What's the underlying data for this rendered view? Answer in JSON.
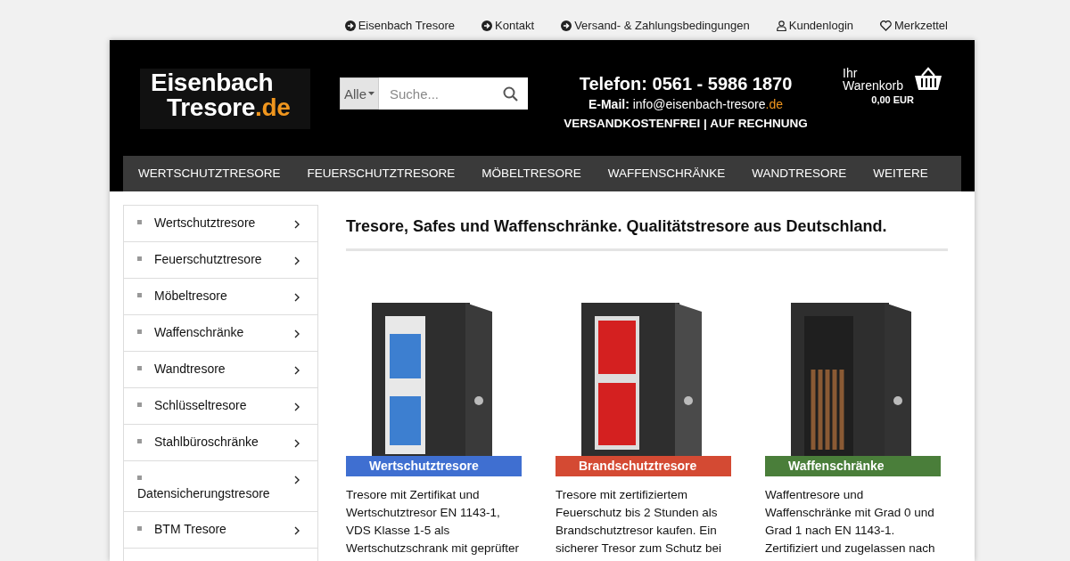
{
  "top_links": [
    {
      "kind": "arrow",
      "label": "Eisenbach Tresore"
    },
    {
      "kind": "arrow",
      "label": "Kontakt"
    },
    {
      "kind": "arrow",
      "label": "Versand- & Zahlungsbedingungen"
    },
    {
      "kind": "user",
      "label": "Kundenlogin"
    },
    {
      "kind": "heart",
      "label": "Merkzettel"
    }
  ],
  "logo": {
    "line1": "Eisenbach",
    "line2": "Tresore",
    "suffix": ".de"
  },
  "search": {
    "category": "Alle",
    "placeholder": "Suche..."
  },
  "contact": {
    "phone": "Telefon: 0561 - 5986 1870",
    "email_label": "E-Mail:",
    "email_name": "info@eisenbach-tresore",
    "email_tld": ".de",
    "tagline": "VERSANDKOSTENFREI | AUF RECHNUNG"
  },
  "cart": {
    "label": "Ihr Warenkorb",
    "total": "0,00 EUR"
  },
  "nav": [
    "WERTSCHUTZTRESORE",
    "FEUERSCHUTZTRESORE",
    "MÖBELTRESORE",
    "WAFFENSCHRÄNKE",
    "WANDTRESORE",
    "WEITERE"
  ],
  "sidebar": {
    "items": [
      "Wertschutztresore",
      "Feuerschutztresore",
      "Möbeltresore",
      "Waffenschränke",
      "Wandtresore",
      "Schlüsseltresore",
      "Stahlbüroschränke",
      "Datensicherungstresore",
      "BTM Tresore"
    ]
  },
  "heading": "Tresore, Safes und Waffenschränke. Qualitätstresore aus Deutschland.",
  "categories": [
    {
      "label": "Wertschutztresore",
      "color": "#3f6fd1",
      "lines": [
        "Tresore mit Zertifikat und",
        "Wertschutztresor EN 1143-1,",
        "VDS Klasse 1-5 als",
        "Wertschutzschrank mit geprüfter"
      ]
    },
    {
      "label": "Brandschutztresore",
      "color": "#d44a33",
      "lines": [
        "Tresore mit zertifiziertem",
        "Feuerschutz bis 2 Stunden als",
        "Brandschutztresor kaufen. Ein",
        "sicherer Tresor zum Schutz bei"
      ]
    },
    {
      "label": "Waffenschränke",
      "color": "#4a7e3a",
      "lines": [
        "Waffentresore und",
        "Waffenschränke mit Grad 0 und",
        "Grad 1 nach EN 1143-1.",
        "Zertifiziert und zugelassen nach"
      ]
    }
  ]
}
